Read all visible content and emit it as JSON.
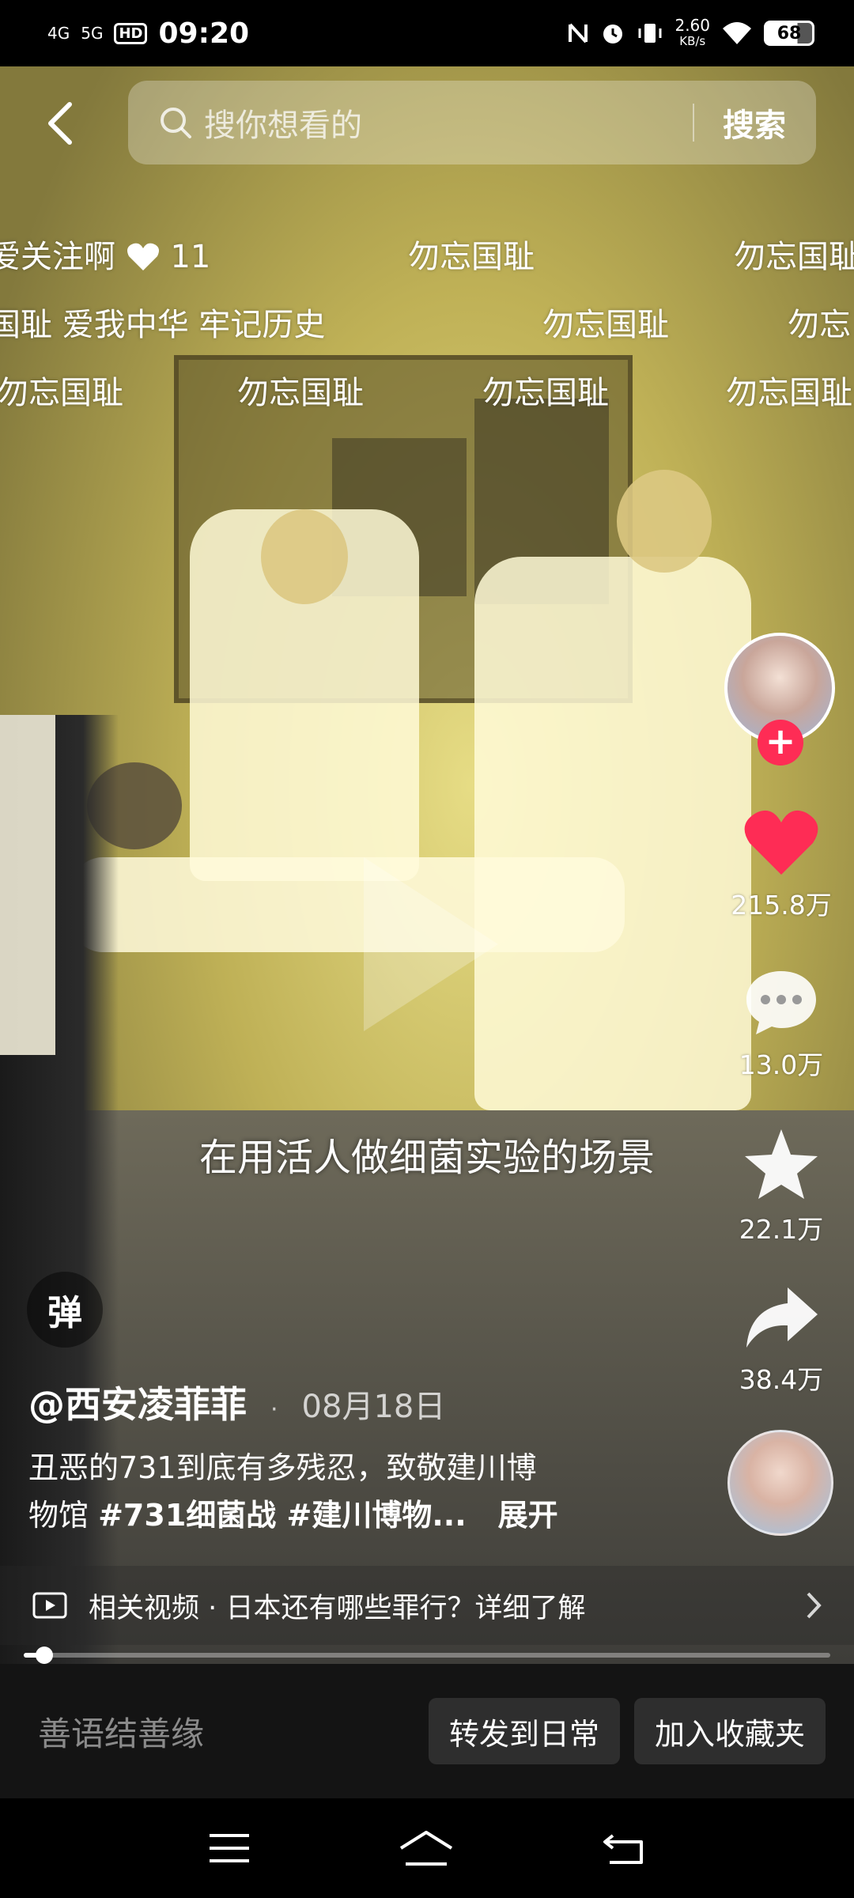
{
  "status_bar": {
    "network_1": "4G",
    "network_2": "5G",
    "hd": "HD",
    "time": "09:20",
    "speed_value": "2.60",
    "speed_unit": "KB/s",
    "battery": "68",
    "battery_level": 0.68
  },
  "search": {
    "placeholder": "搜你想看的",
    "button": "搜索"
  },
  "danmaku": [
    "爱关注啊",
    "11",
    "勿忘国耻",
    "勿忘国耻",
    "国耻 爱我中华 牢记历史",
    "勿忘国耻",
    "勿忘",
    "勿忘国耻",
    "勿忘国耻",
    "勿忘国耻",
    "勿忘国耻"
  ],
  "subtitle": "在用活人做细菌实验的场景",
  "rail": {
    "likes": "215.8万",
    "comments": "13.0万",
    "favorites": "22.1万",
    "shares": "38.4万",
    "follow": "+"
  },
  "danmu_toggle": "弹",
  "author": "@西安凌菲菲",
  "separator": "·",
  "date": "08月18日",
  "description": {
    "text_line1": "丑恶的731到底有多残忍，致敬建川博",
    "text_line2_prefix": "物馆 ",
    "tags": "#731细菌战 #建川博物...",
    "expand": "展开"
  },
  "related": {
    "label": "相关视频",
    "dot": "·",
    "text": "日本还有哪些罪行？详细了解"
  },
  "progress": 0.025,
  "action_bar": {
    "comment_placeholder": "善语结善缘",
    "repost": "转发到日常",
    "favorite": "加入收藏夹"
  },
  "icons": {
    "back": "back-arrow-icon",
    "search": "search-icon",
    "heart": "heart-icon",
    "comment": "comment-icon",
    "star": "star-icon",
    "share": "share-icon",
    "video": "video-icon",
    "menu": "menu-icon",
    "home": "home-icon",
    "back_nav": "back-nav-icon"
  },
  "colors": {
    "like_red": "#fe2c55",
    "follow_red": "#fe2c55",
    "action_bar_bg": "#141414",
    "pill_bg": "#2e2e2e"
  }
}
